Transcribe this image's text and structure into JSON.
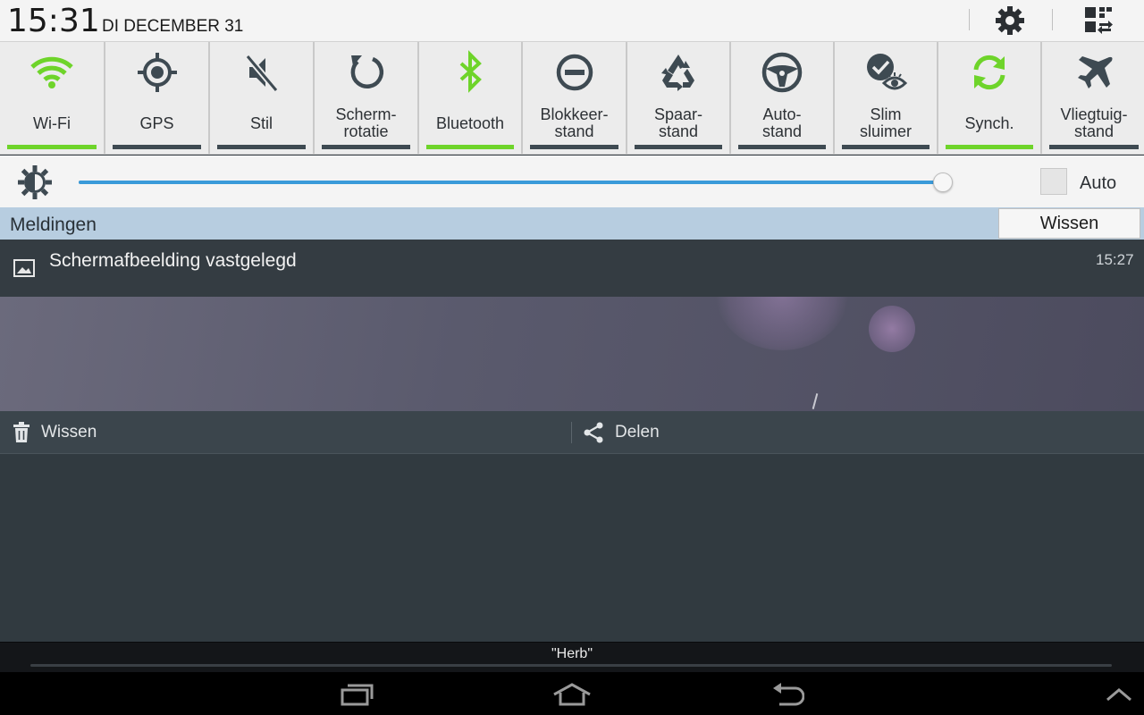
{
  "status": {
    "time": "15:31",
    "date": "DI DECEMBER 31"
  },
  "header_buttons": {
    "settings_icon": "gear-icon",
    "edit_icon": "edit-toggles-icon"
  },
  "toggles": [
    {
      "label": "Wi-Fi",
      "icon": "wifi-icon",
      "active": true
    },
    {
      "label": "GPS",
      "icon": "gps-icon",
      "active": false
    },
    {
      "label": "Stil",
      "icon": "mute-icon",
      "active": false
    },
    {
      "label": "Scherm-\nrotatie",
      "icon": "rotate-icon",
      "active": false
    },
    {
      "label": "Bluetooth",
      "icon": "bluetooth-icon",
      "active": true
    },
    {
      "label": "Blokkeer-\nstand",
      "icon": "block-icon",
      "active": false
    },
    {
      "label": "Spaar-\nstand",
      "icon": "recycle-icon",
      "active": false
    },
    {
      "label": "Auto-\nstand",
      "icon": "steering-wheel-icon",
      "active": false
    },
    {
      "label": "Slim\nsluimer",
      "icon": "smart-stay-icon",
      "active": false
    },
    {
      "label": "Synch.",
      "icon": "sync-icon",
      "active": true
    },
    {
      "label": "Vliegtuig-\nstand",
      "icon": "airplane-icon",
      "active": false
    }
  ],
  "brightness": {
    "level": 0.997,
    "auto_label": "Auto",
    "auto_checked": false
  },
  "notifications": {
    "header": "Meldingen",
    "clear_label": "Wissen",
    "items": [
      {
        "title": "Schermafbeelding vastgelegd",
        "time": "15:27",
        "actions": [
          {
            "label": "Wissen",
            "icon": "trash-icon"
          },
          {
            "label": "Delen",
            "icon": "share-icon"
          }
        ]
      }
    ]
  },
  "carrier": "\"Herb\"",
  "colors": {
    "active": "#6ed42a",
    "inactive": "#3e4a52",
    "slider": "#3a9ad9"
  }
}
